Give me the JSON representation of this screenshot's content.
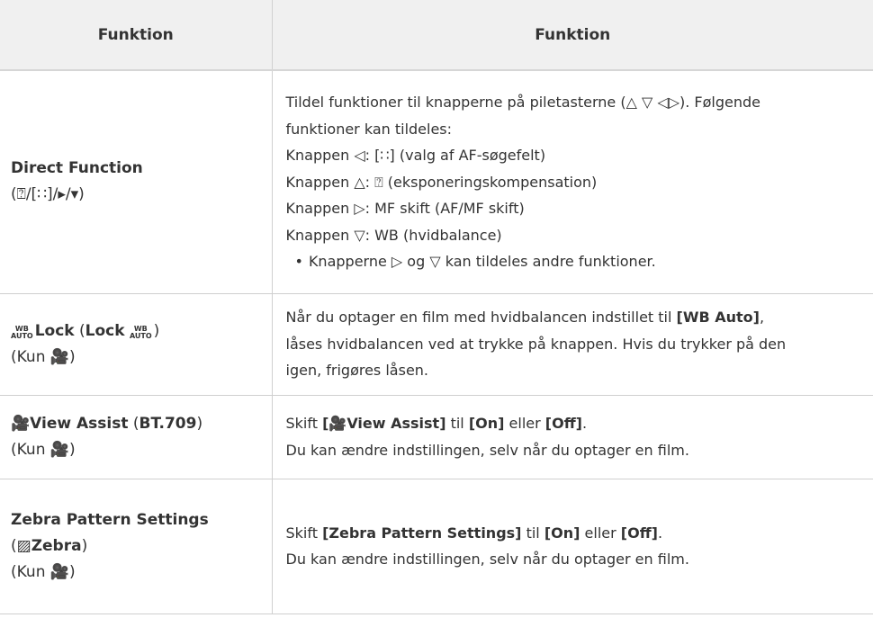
{
  "header": {
    "col1": "Funktion",
    "col2": "Funktion"
  },
  "rows": [
    {
      "name_main": "Direct Function",
      "name_sub": "(⍰/[∷]/▸/▾)",
      "desc": {
        "intro_1": "Tildel funktioner til knapperne på piletasterne (△ ▽ ◁▷). Følgende",
        "intro_2": "funktioner kan tildeles:",
        "line_left": "Knappen ◁: [∷] (valg af AF-søgefelt)",
        "line_up": "Knappen △: ⍰ (eksponeringskompensation)",
        "line_right": "Knappen ▷: MF skift (AF/MF skift)",
        "line_down": "Knappen ▽: WB (hvidbalance)",
        "bullet": "Knapperne ▷ og ▽ kan tildeles andre funktioner."
      }
    },
    {
      "badge_top": "WB",
      "badge_bottom": "AUTO",
      "name_main": "Lock",
      "name_paren_bold": "Lock",
      "name_sub2": "(Kun 🎥)",
      "desc": {
        "line_1a": "Når du optager en film med hvidbalancen indstillet til ",
        "line_1b": "[WB Auto]",
        "line_1c": ",",
        "line_2": "låses hvidbalancen ved at trykke på knappen. Hvis du trykker på den",
        "line_3": "igen, frigøres låsen."
      }
    },
    {
      "name_main": "🎥View Assist",
      "name_paren": "BT.709",
      "name_sub2": "(Kun 🎥)",
      "desc": {
        "line_1a": "Skift ",
        "line_1b": "[🎥View Assist]",
        "line_1c": " til ",
        "line_1d": "[On]",
        "line_1e": " eller ",
        "line_1f": "[Off]",
        "line_1g": ".",
        "line_2": "Du kan ændre indstillingen, selv når du optager en film."
      }
    },
    {
      "name_main": "Zebra Pattern Settings",
      "name_paren": "▨Zebra",
      "name_sub2": "(Kun 🎥)",
      "desc": {
        "line_1a": "Skift ",
        "line_1b": "[Zebra Pattern Settings]",
        "line_1c": " til ",
        "line_1d": "[On]",
        "line_1e": " eller ",
        "line_1f": "[Off]",
        "line_1g": ".",
        "line_2": "Du kan ændre indstillingen, selv når du optager en film."
      }
    }
  ]
}
